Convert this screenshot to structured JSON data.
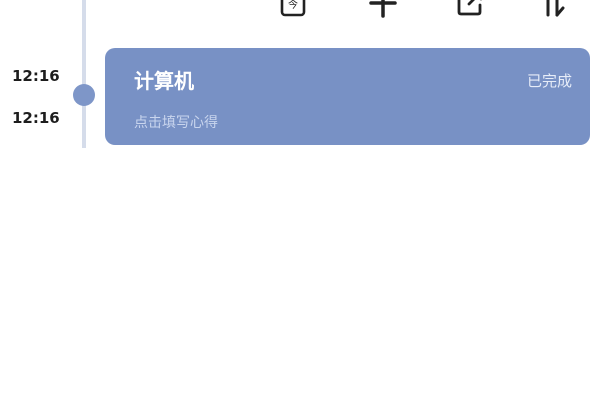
{
  "toolbar": {
    "today_icon": "calendar-today-icon",
    "today_glyph": "今",
    "add_icon": "plus-icon",
    "share_icon": "share-export-icon",
    "sort_icon": "sort-icon"
  },
  "timeline": {
    "start_time": "12:16",
    "end_time": "12:16"
  },
  "task": {
    "title": "计算机",
    "status": "已完成",
    "note_placeholder": "点击填写心得",
    "color": "#7891c5"
  },
  "colors": {
    "accent": "#7891c5",
    "timeline_line": "#d5dcea",
    "timeline_dot": "#7e96c8"
  }
}
